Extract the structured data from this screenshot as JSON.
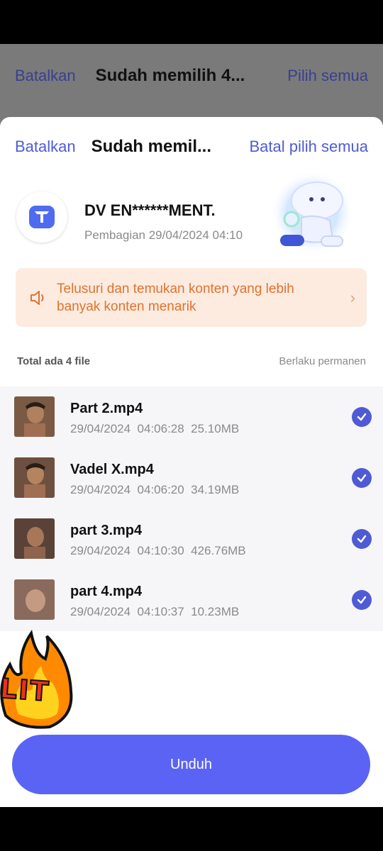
{
  "background_header": {
    "cancel_label": "Batalkan",
    "title": "Sudah memilih 4...",
    "select_all_label": "Pilih semua"
  },
  "sheet": {
    "header": {
      "cancel_label": "Batalkan",
      "title": "Sudah memil...",
      "deselect_all_label": "Batal pilih semua"
    },
    "sharer": {
      "name": "DV EN******MENT.",
      "meta": "Pembagian 29/04/2024 04:10"
    },
    "banner": {
      "text": "Telusuri dan temukan konten yang lebih banyak konten menarik"
    },
    "summary": {
      "total": "Total ada 4 file",
      "validity": "Berlaku permanen"
    },
    "files": [
      {
        "name": "Part 2.mp4",
        "meta": "29/04/2024  04:06:28  25.10MB",
        "selected": true
      },
      {
        "name": "Vadel X.mp4",
        "meta": "29/04/2024  04:06:20  34.19MB",
        "selected": true
      },
      {
        "name": "part 3.mp4",
        "meta": "29/04/2024  04:10:30  426.76MB",
        "selected": true
      },
      {
        "name": "part 4.mp4",
        "meta": "29/04/2024  04:10:37  10.23MB",
        "selected": true
      }
    ],
    "sticker_text": "LIT",
    "download_label": "Unduh"
  },
  "colors": {
    "accent": "#4f5bd5",
    "button": "#5b63f5",
    "banner_bg": "#fdebe0",
    "banner_text": "#e0722e"
  }
}
